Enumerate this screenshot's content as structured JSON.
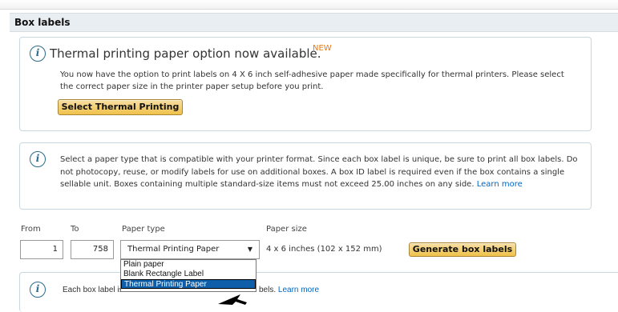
{
  "section": {
    "title": "Box labels"
  },
  "thermal_notice": {
    "icon": "info-icon",
    "title": "Thermal printing paper option now available.",
    "badge": "NEW",
    "body": "You now have the option to print labels on 4 X 6 inch self-adhesive paper made specifically for thermal printers. Please select the correct paper size in the printer paper setup before you print.",
    "button_label": "Select Thermal Printing"
  },
  "paper_notice": {
    "icon": "info-icon",
    "body": "Select a paper type that is compatible with your printer format. Since each box label is unique, be sure to print all box labels. Do not photocopy, reuse, or modify labels for use on additional boxes. A box ID label is required even if the box contains a single sellable unit. Boxes containing multiple standard-size items must not exceed 25.00 inches on any side.",
    "link": "Learn more"
  },
  "form": {
    "from_label": "From",
    "to_label": "To",
    "paper_type_label": "Paper type",
    "paper_size_label": "Paper size",
    "from_value": "1",
    "to_value": "758",
    "paper_type_selected": "Thermal Printing Paper",
    "paper_size_value": "4 x 6 inches (102 x 152 mm)",
    "generate_label": "Generate box labels",
    "options": [
      "Plain paper",
      "Blank Rectangle Label",
      "Thermal Printing Paper"
    ]
  },
  "bottom_notice": {
    "icon": "info-icon",
    "text_before": "Each box label is",
    "text_after": "bels.",
    "link": "Learn more"
  },
  "colors": {
    "accent_orange": "#e47911",
    "link_blue": "#0066c0",
    "selected_blue": "#0f5ea9",
    "button_yellow": "#f0c14b"
  }
}
